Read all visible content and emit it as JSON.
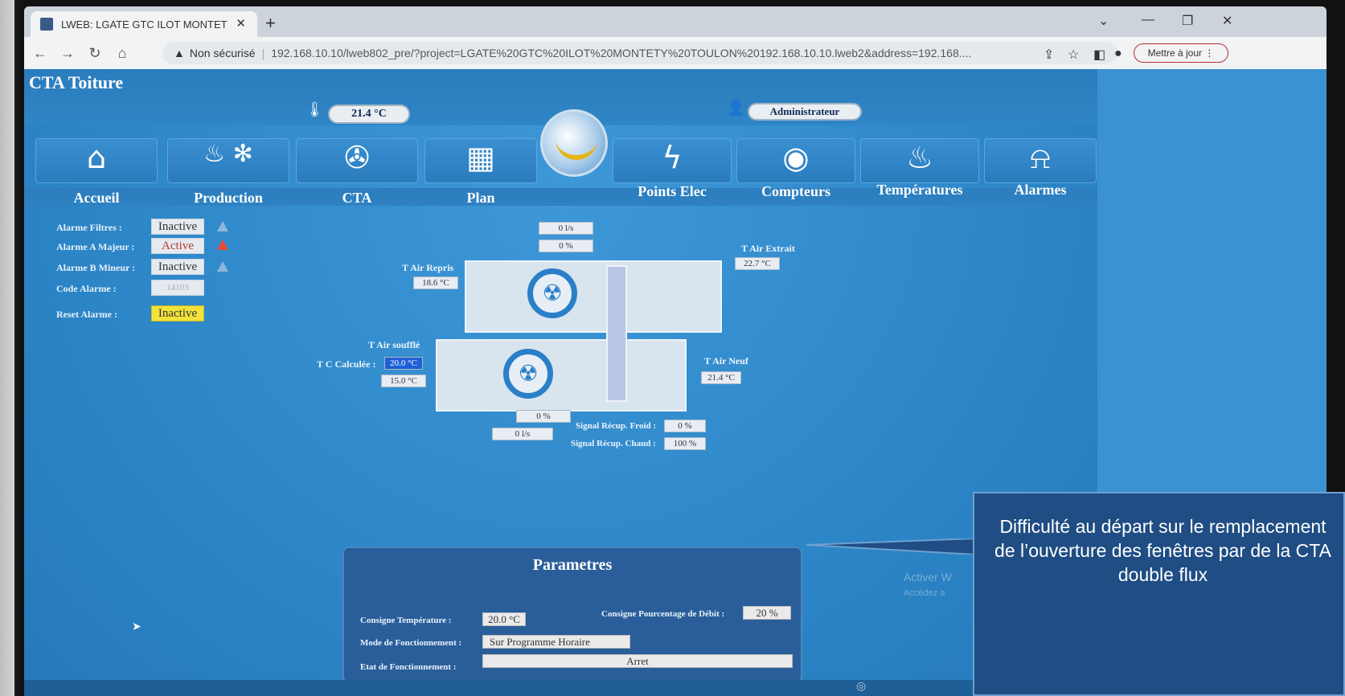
{
  "browser": {
    "tab_title": "LWEB: LGATE GTC ILOT MONTET  ×",
    "tab_title_text": "LWEB: LGATE GTC ILOT MONTET",
    "new_tab": "+",
    "security": "Non sécurisé",
    "url": "192.168.10.10/lweb802_pre/?project=LGATE%20GTC%20ILOT%20MONTETY%20TOULON%20192.168.10.10.lweb2&address=192.168....",
    "update_label": "Mettre à jour"
  },
  "app": {
    "title": "CTA Toiture",
    "temperature": "21.4 °C",
    "user": "Administrateur",
    "nav": [
      {
        "label": "Accueil",
        "icon": "home-icon",
        "glyph": "⌂"
      },
      {
        "label": "Production",
        "icon": "heat-cool-icon",
        "glyph": "♨ ✻"
      },
      {
        "label": "CTA",
        "icon": "fan-icon",
        "glyph": "✇"
      },
      {
        "label": "Plan",
        "icon": "building-icon",
        "glyph": "▦"
      },
      {
        "label": "Points Elec",
        "icon": "lightning-icon",
        "glyph": "ϟ"
      },
      {
        "label": "Compteurs",
        "icon": "meter-icon",
        "glyph": "◉"
      },
      {
        "label": "Températures",
        "icon": "heat-waves-icon",
        "glyph": "♨"
      },
      {
        "label": "Alarmes",
        "icon": "bell-icon",
        "glyph": "⍾"
      }
    ]
  },
  "alarms": {
    "filtres_label": "Alarme Filtres :",
    "filtres_value": "Inactive",
    "majeur_label": "Alarme A Majeur :",
    "majeur_value": "Active",
    "mineur_label": "Alarme B Mineur :",
    "mineur_value": "Inactive",
    "code_label": "Code Alarme :",
    "code_value": "14103",
    "reset_label": "Reset Alarme :",
    "reset_value": "Inactive"
  },
  "diagram": {
    "flow_top": "0 l/s",
    "pct_top": "0 %",
    "t_air_extrait_label": "T Air Extrait",
    "t_air_extrait": "22.7 °C",
    "t_air_repris_label": "T Air Repris",
    "t_air_repris": "18.6 °C",
    "t_air_souffle_label": "T Air soufflé",
    "tc_calculee_label": "T C Calculée :",
    "tc_calculee": "20.0 °C",
    "t_souffle": "15.0 °C",
    "t_air_neuf_label": "T Air Neuf",
    "t_air_neuf": "21.4 °C",
    "pct_bottom": "0 %",
    "flow_bottom": "0 l/s",
    "recup_froid_label": "Signal Récup. Froid :",
    "recup_froid": "0 %",
    "recup_chaud_label": "Signal Récup. Chaud :",
    "recup_chaud": "100 %"
  },
  "params": {
    "title": "Parametres",
    "consigne_temp_label": "Consigne Température :",
    "consigne_temp": "20.0 °C",
    "consigne_debit_label": "Consigne Pourcentage de Débit :",
    "consigne_debit": "20 %",
    "mode_label": "Mode de Fonctionnement :",
    "mode": "Sur Programme Horaire",
    "etat_label": "Etat de Fonctionnement :",
    "etat": "Arret"
  },
  "callout": {
    "text": "Difficulté au départ sur le remplacement de l’ouverture des fenêtres par de la CTA double flux"
  },
  "watermark": {
    "line1": "Activer W",
    "line2": "Accédez a"
  },
  "colors": {
    "active_alarm": "#c0392b",
    "reset_yellow": "#f2e23a",
    "tc_highlight": "#1f5fd6"
  }
}
